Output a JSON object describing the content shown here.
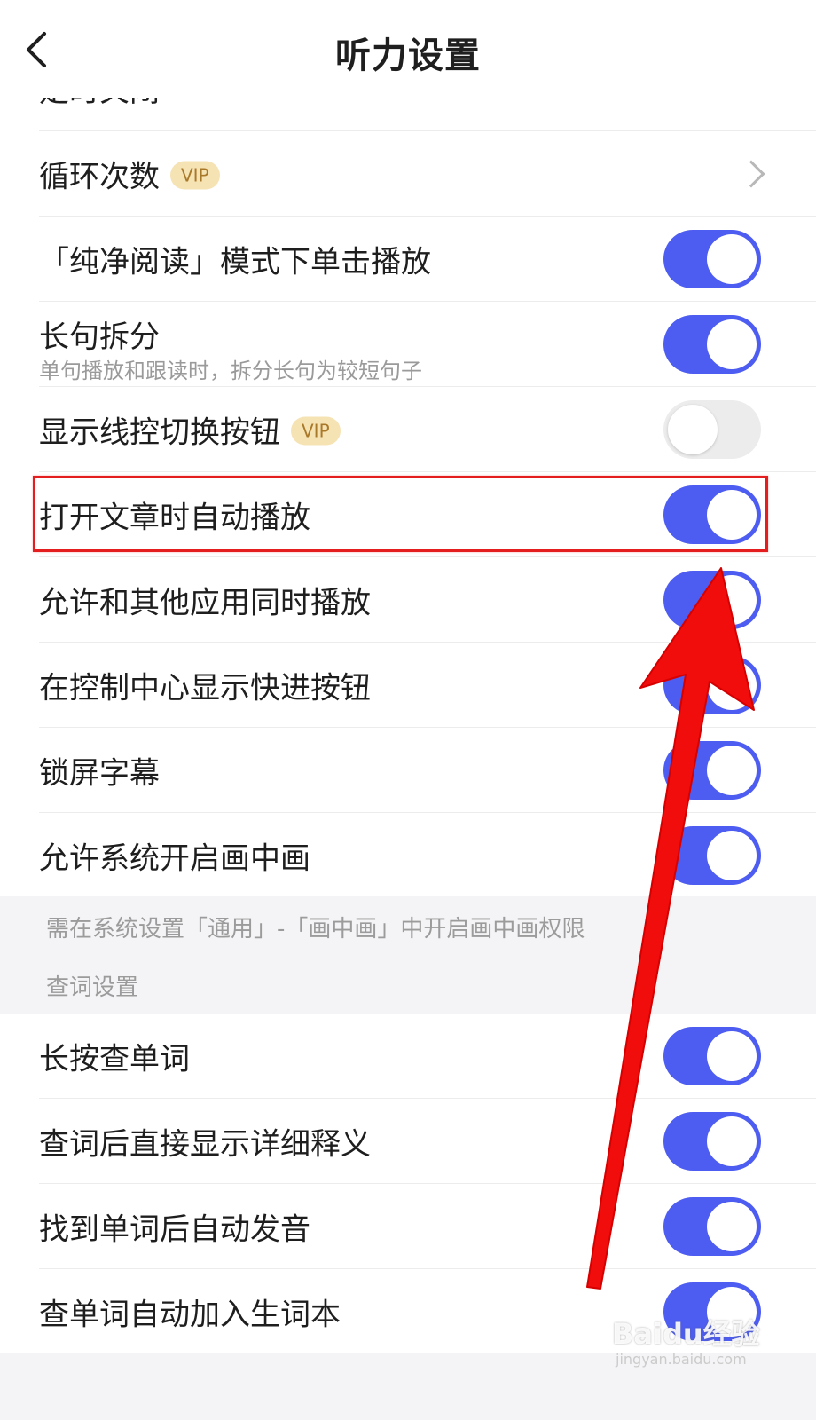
{
  "header": {
    "title": "听力设置",
    "back_icon": "chevron-left-icon"
  },
  "rows_top": [
    {
      "label": "定时关闭",
      "control": "chevron"
    },
    {
      "label": "循环次数",
      "badge": "VIP",
      "control": "chevron"
    },
    {
      "label": "「纯净阅读」模式下单击播放",
      "control": "toggle",
      "on": true
    },
    {
      "label": "长句拆分",
      "sub": "单句播放和跟读时，拆分长句为较短句子",
      "control": "toggle",
      "on": true
    },
    {
      "label": "显示线控切换按钮",
      "badge": "VIP",
      "control": "toggle",
      "on": false
    },
    {
      "label": "打开文章时自动播放",
      "control": "toggle",
      "on": true
    },
    {
      "label": "允许和其他应用同时播放",
      "control": "toggle",
      "on": true
    },
    {
      "label": "在控制中心显示快进按钮",
      "control": "toggle",
      "on": true
    },
    {
      "label": "锁屏字幕",
      "control": "toggle",
      "on": true
    },
    {
      "label": "允许系统开启画中画",
      "control": "toggle",
      "on": true
    }
  ],
  "pip_note": "需在系统设置「通用」-「画中画」中开启画中画权限",
  "lookup_section_title": "查词设置",
  "rows_lookup": [
    {
      "label": "长按查单词",
      "control": "toggle",
      "on": true
    },
    {
      "label": "查词后直接显示详细释义",
      "control": "toggle",
      "on": true
    },
    {
      "label": "找到单词后自动发音",
      "control": "toggle",
      "on": true
    },
    {
      "label": "查单词自动加入生词本",
      "control": "toggle",
      "on": true
    }
  ],
  "colors": {
    "toggle_on": "#4e5df1",
    "toggle_off": "#ececec",
    "vip_bg": "#f6e3b4",
    "vip_text": "#a9792a",
    "annotation_red": "#e41e1e",
    "section_bg": "#f4f4f6"
  },
  "watermark": {
    "main": "Baidu经验",
    "sub": "jingyan.baidu.com"
  }
}
